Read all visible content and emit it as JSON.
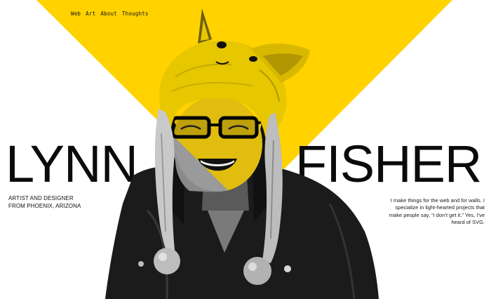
{
  "nav": {
    "items": [
      {
        "label": "Web"
      },
      {
        "label": "Art"
      },
      {
        "label": "About"
      },
      {
        "label": "Thoughts"
      }
    ]
  },
  "hero": {
    "first_name": "LYNN",
    "last_name": "FISHER"
  },
  "tagline": {
    "line1": "ARTIST AND DESIGNER",
    "line2": "FROM PHOENIX, ARIZONA"
  },
  "bio": {
    "text": "I make things for the web and for walls. I specialize in light-hearted projects that make people say, “I don’t get it.” Yes, I’ve heard of SVG."
  },
  "colors": {
    "accent": "#FFD200",
    "text": "#111111",
    "background": "#FFFFFF"
  },
  "icons": {
    "portrait": "person-in-animal-hat-photo"
  }
}
